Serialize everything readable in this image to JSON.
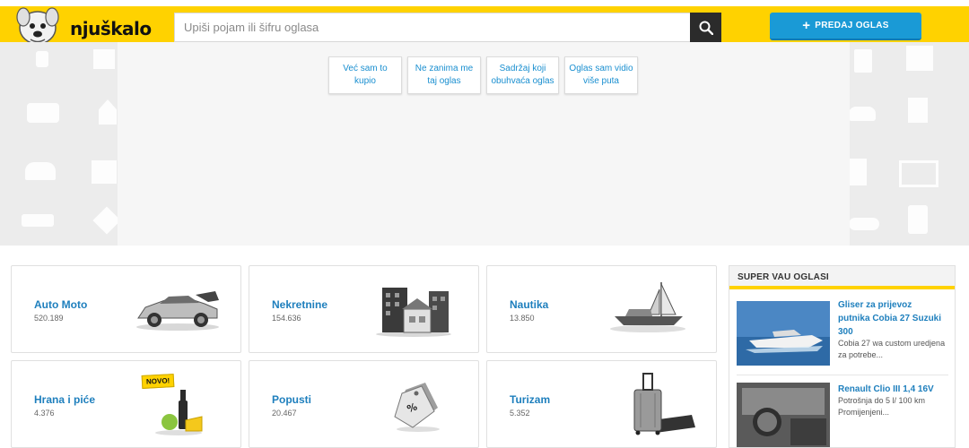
{
  "header": {
    "logo_text": "njuškalo",
    "search_placeholder": "Upiši pojam ili šifru oglasa",
    "sell_label": "PREDAJ OGLAS",
    "brand_color": "#ffd200",
    "accent_color": "#1a9ad6"
  },
  "feedback": [
    {
      "line1": "Već sam to",
      "line2": "kupio"
    },
    {
      "line1": "Ne zanima me",
      "line2": "taj oglas"
    },
    {
      "line1": "Sadržaj koji",
      "line2": "obuhvaća oglas"
    },
    {
      "line1": "Oglas sam vidio",
      "line2": "više puta"
    }
  ],
  "categories": [
    {
      "name": "Auto Moto",
      "count": "520.189",
      "icon": "car-icon"
    },
    {
      "name": "Nekretnine",
      "count": "154.636",
      "icon": "buildings-icon"
    },
    {
      "name": "Nautika",
      "count": "13.850",
      "icon": "boat-icon"
    },
    {
      "name": "Hrana i piće",
      "count": "4.376",
      "icon": "food-icon",
      "badge": "NOVO!"
    },
    {
      "name": "Popusti",
      "count": "20.467",
      "icon": "discount-tag-icon"
    },
    {
      "name": "Turizam",
      "count": "5.352",
      "icon": "suitcase-icon"
    }
  ],
  "sidebar": {
    "title": "SUPER VAU OGLASI",
    "items": [
      {
        "title": "Gliser za prijevoz putnika Cobia 27 Suzuki 300",
        "desc": "Cobia 27 wa custom uredjena za potrebe..."
      },
      {
        "title": "Renault Clio III 1,4 16V",
        "desc": "Potrošnja do 5 l/ 100 km Promijenjeni..."
      }
    ]
  }
}
